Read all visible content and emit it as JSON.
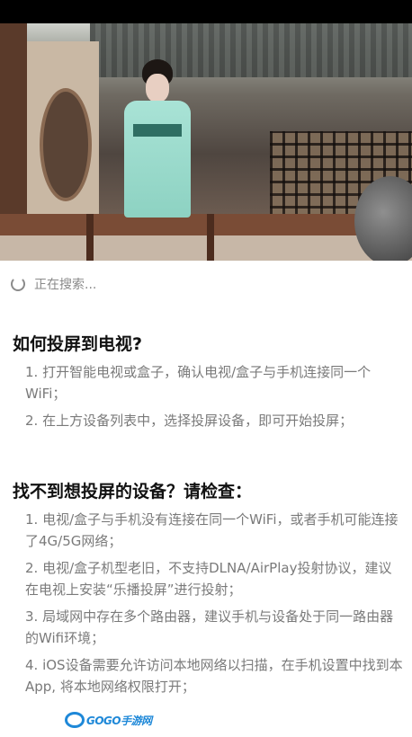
{
  "status": {
    "searching_text": "正在搜索..."
  },
  "section1": {
    "title": "如何投屏到电视?",
    "items": [
      "1. 打开智能电视或盒子，确认电视/盒子与手机连接同一个WiFi；",
      "2. 在上方设备列表中，选择投屏设备，即可开始投屏；"
    ]
  },
  "section2": {
    "title": "找不到想投屏的设备？请检查：",
    "items": [
      "1. 电视/盒子与手机没有连接在同一个WiFi，或者手机可能连接了4G/5G网络；",
      "2. 电视/盒子机型老旧，不支持DLNA/AirPlay投射协议，建议在电视上安装“乐播投屏”进行投射；",
      "3. 局域网中存在多个路由器，建议手机与设备处于同一路由器的Wifi环境；",
      "4. iOS设备需要允许访问本地网络以扫描，在手机设置中找到本App, 将本地网络权限打开；"
    ]
  },
  "watermark": {
    "text": "GOGO手游网"
  }
}
